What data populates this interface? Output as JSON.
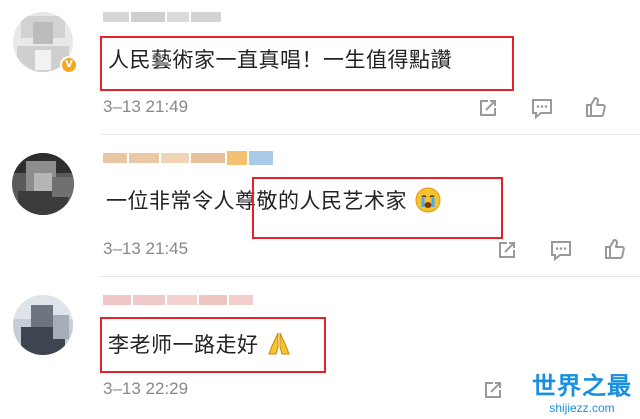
{
  "comments": [
    {
      "text": "人民藝術家一直真唱！一生值得點讚",
      "time": "3–13 21:49",
      "verified": true
    },
    {
      "text": "一位非常令人尊敬的人民艺术家",
      "time": "3–13 21:45",
      "verified": false
    },
    {
      "text": "李老师一路走好",
      "time": "3–13 22:29",
      "verified": false
    }
  ],
  "actions": {
    "share_icon": "share-icon",
    "comment_icon": "comment-icon",
    "like_icon": "like-icon"
  },
  "watermark": {
    "title": "世界之最",
    "domain": "shijiezz.com"
  },
  "colors": {
    "highlight_box": "#e8202a",
    "muted_text": "#888888",
    "verified_badge": "#f5a623",
    "watermark": "#1a8fe0"
  }
}
